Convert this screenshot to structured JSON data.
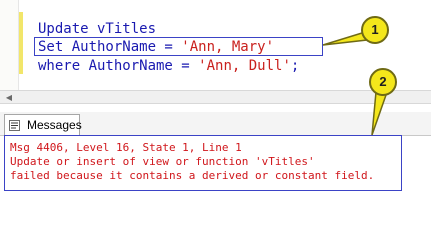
{
  "editor": {
    "code_lines": [
      {
        "keyword_part": "Update vTitles",
        "string_part": ""
      },
      {
        "keyword_part": "Set AuthorName = ",
        "string_part": "'Ann, Mary'"
      },
      {
        "keyword_part": "where AuthorName = ",
        "string_part": "'Ann, Dull'",
        "suffix": ";"
      }
    ]
  },
  "results": {
    "tab_label": "Messages",
    "messages": [
      "Msg 4406, Level 16, State 1, Line 1",
      "Update or insert of view or function 'vTitles'",
      "failed because it contains a derived or constant field."
    ]
  },
  "callouts": [
    "1",
    "2"
  ],
  "colors": {
    "keyword": "#1a1ab0",
    "string": "#c9211e",
    "error_text": "#d0161b",
    "highlight_border": "#3b43c6",
    "callout_fill": "#f4e71b"
  },
  "icons": [
    "messages-icon",
    "scroll-left-arrow-icon"
  ]
}
